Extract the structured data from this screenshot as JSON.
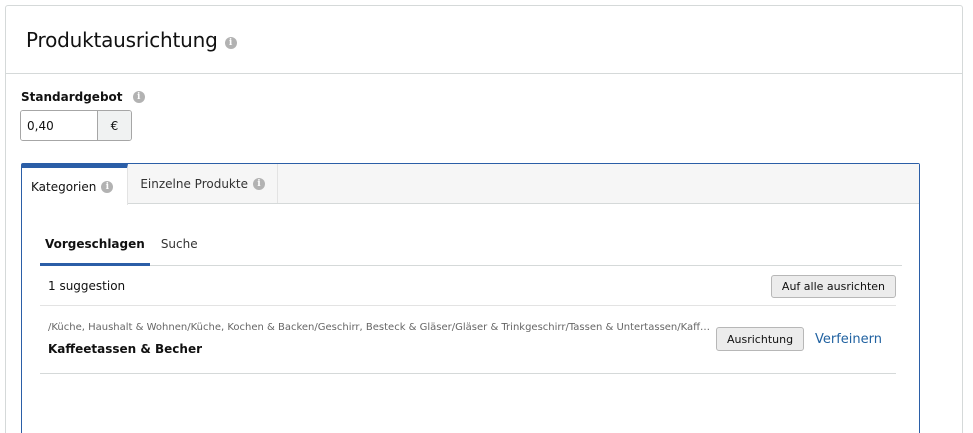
{
  "panel": {
    "title": "Produktausrichtung",
    "title_info_icon": "info-icon"
  },
  "bid": {
    "label": "Standardgebot",
    "value": "0,40",
    "currency": "€"
  },
  "tabs": [
    {
      "label": "Kategorien",
      "active": true
    },
    {
      "label": "Einzelne Produkte",
      "active": false
    }
  ],
  "subtabs": [
    {
      "label": "Vorgeschlagen",
      "active": true
    },
    {
      "label": "Suche",
      "active": false
    }
  ],
  "suggestions": {
    "count_label": "1 suggestion",
    "target_all_label": "Auf alle ausrichten",
    "items": [
      {
        "path": "/Küche, Haushalt & Wohnen/Küche, Kochen & Backen/Geschirr, Besteck & Gläser/Gläser & Trinkgeschirr/Tassen & Untertassen/Kaffeetassen & Becher",
        "name": "Kaffeetassen & Becher",
        "target_label": "Ausrichtung",
        "refine_label": "Verfeinern"
      }
    ]
  },
  "colors": {
    "accent": "#2b5ea7",
    "link": "#2162a1",
    "border": "#d5d9d9"
  }
}
